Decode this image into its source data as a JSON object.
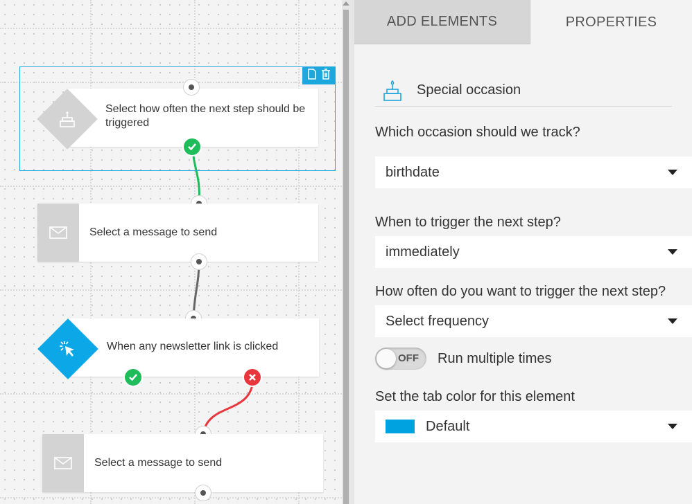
{
  "canvas": {
    "nodes": [
      {
        "text": "Select how often the next step should be triggered",
        "icon": "cake-icon",
        "kind": "diamond"
      },
      {
        "text": "Select a message to send",
        "icon": "envelope-icon",
        "kind": "box"
      },
      {
        "text": "When any newsletter link is clicked",
        "icon": "cursor-click-icon",
        "kind": "diamond"
      },
      {
        "text": "Select a message to send",
        "icon": "envelope-icon",
        "kind": "box"
      }
    ],
    "connections": [
      {
        "color": "#1fbd5a"
      },
      {
        "color": "#666666"
      },
      {
        "color": "#e8363d"
      }
    ],
    "selection_tools": [
      "copy-icon",
      "trash-icon"
    ]
  },
  "panel": {
    "tabs": [
      {
        "label": "ADD ELEMENTS",
        "active": false
      },
      {
        "label": "PROPERTIES",
        "active": true
      }
    ],
    "section_title": "Special occasion",
    "occasion_label": "Which occasion should we track?",
    "occasion_value": "birthdate",
    "trigger_label": "When to trigger the next step?",
    "trigger_value": "immediately",
    "frequency_label": "How often do you want to trigger the next step?",
    "frequency_value": "Select frequency",
    "toggle_state": "OFF",
    "toggle_label": "Run multiple times",
    "color_label": "Set the tab color for this element",
    "color_value": "Default",
    "color_swatch": "#00a3e0"
  }
}
